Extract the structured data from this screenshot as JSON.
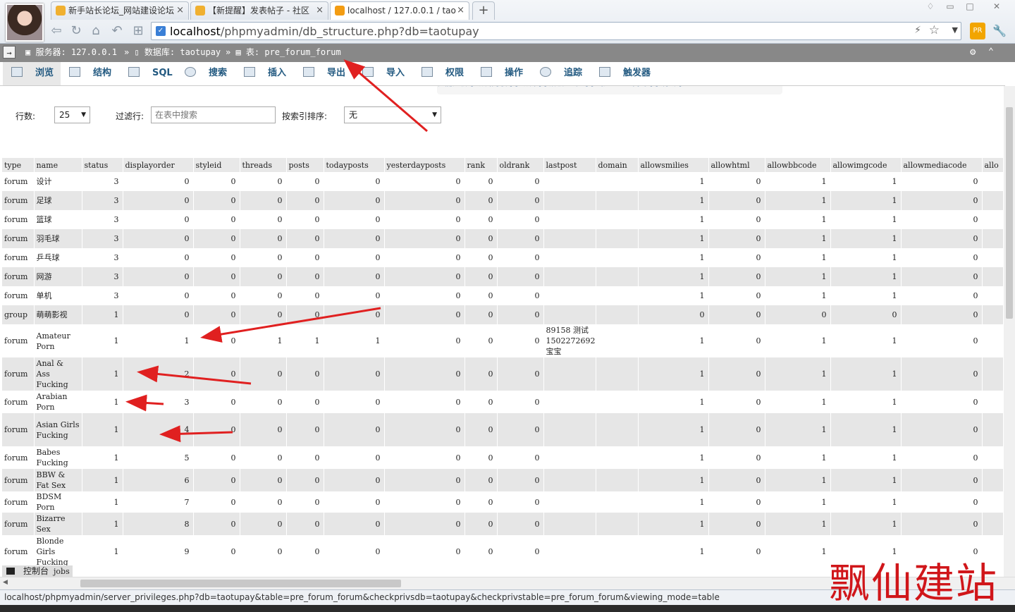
{
  "browser": {
    "tabs": [
      {
        "title": "新手站长论坛_网站建设论坛",
        "close": "×"
      },
      {
        "title": "【新提醒】发表帖子 - 社区",
        "close": "×"
      },
      {
        "title": "localhost / 127.0.0.1 / tao",
        "close": "×"
      }
    ],
    "new_tab": "+",
    "url_host": "localhost",
    "url_path": "/phpmyadmin/db_structure.php?db=taotupay"
  },
  "pma": {
    "crumbs": {
      "server": "服务器: 127.0.0.1",
      "database": "数据库: taotupay",
      "table": "表: pre_forum_forum"
    },
    "menu": [
      "浏览",
      "结构",
      "SQL",
      "搜索",
      "插入",
      "导出",
      "导入",
      "权限",
      "操作",
      "追踪",
      "触发器"
    ],
    "subline": "性能分析 [ 编辑内联 ] [ 编辑 ] [ 解析 SQL ] [ 创建 PHP 代码 ] [ 刷新 ]"
  },
  "filters": {
    "rows_label": "行数:",
    "rows_value": "25",
    "filter_label": "过滤行:",
    "filter_placeholder": "在表中搜索",
    "sort_label": "按索引排序:",
    "sort_value": "无"
  },
  "table": {
    "columns": [
      "type",
      "name",
      "status",
      "displayorder",
      "styleid",
      "threads",
      "posts",
      "todayposts",
      "yesterdayposts",
      "rank",
      "oldrank",
      "lastpost",
      "domain",
      "allowsmilies",
      "allowhtml",
      "allowbbcode",
      "allowimgcode",
      "allowmediacode",
      "allo"
    ],
    "rows": [
      [
        "forum",
        "设计",
        "3",
        "0",
        "0",
        "0",
        "0",
        "0",
        "0",
        "0",
        "0",
        "",
        "",
        "1",
        "0",
        "1",
        "1",
        "0"
      ],
      [
        "forum",
        "足球",
        "3",
        "0",
        "0",
        "0",
        "0",
        "0",
        "0",
        "0",
        "0",
        "",
        "",
        "1",
        "0",
        "1",
        "1",
        "0"
      ],
      [
        "forum",
        "篮球",
        "3",
        "0",
        "0",
        "0",
        "0",
        "0",
        "0",
        "0",
        "0",
        "",
        "",
        "1",
        "0",
        "1",
        "1",
        "0"
      ],
      [
        "forum",
        "羽毛球",
        "3",
        "0",
        "0",
        "0",
        "0",
        "0",
        "0",
        "0",
        "0",
        "",
        "",
        "1",
        "0",
        "1",
        "1",
        "0"
      ],
      [
        "forum",
        "乒乓球",
        "3",
        "0",
        "0",
        "0",
        "0",
        "0",
        "0",
        "0",
        "0",
        "",
        "",
        "1",
        "0",
        "1",
        "1",
        "0"
      ],
      [
        "forum",
        "网游",
        "3",
        "0",
        "0",
        "0",
        "0",
        "0",
        "0",
        "0",
        "0",
        "",
        "",
        "1",
        "0",
        "1",
        "1",
        "0"
      ],
      [
        "forum",
        "单机",
        "3",
        "0",
        "0",
        "0",
        "0",
        "0",
        "0",
        "0",
        "0",
        "",
        "",
        "1",
        "0",
        "1",
        "1",
        "0"
      ],
      [
        "group",
        "萌萌影视",
        "1",
        "0",
        "0",
        "0",
        "0",
        "0",
        "0",
        "0",
        "0",
        "",
        "",
        "0",
        "0",
        "0",
        "0",
        "0"
      ],
      [
        "forum",
        "Amateur Porn",
        "1",
        "1",
        "0",
        "1",
        "1",
        "1",
        "0",
        "0",
        "0",
        "89158 测试 1502272692 宝宝",
        "",
        "1",
        "0",
        "1",
        "1",
        "0"
      ],
      [
        "forum",
        "Anal & Ass Fucking",
        "1",
        "2",
        "0",
        "0",
        "0",
        "0",
        "0",
        "0",
        "0",
        "",
        "",
        "1",
        "0",
        "1",
        "1",
        "0"
      ],
      [
        "forum",
        "Arabian Porn",
        "1",
        "3",
        "0",
        "0",
        "0",
        "0",
        "0",
        "0",
        "0",
        "",
        "",
        "1",
        "0",
        "1",
        "1",
        "0"
      ],
      [
        "forum",
        "Asian Girls Fucking",
        "1",
        "4",
        "0",
        "0",
        "0",
        "0",
        "0",
        "0",
        "0",
        "",
        "",
        "1",
        "0",
        "1",
        "1",
        "0"
      ],
      [
        "forum",
        "Babes Fucking",
        "1",
        "5",
        "0",
        "0",
        "0",
        "0",
        "0",
        "0",
        "0",
        "",
        "",
        "1",
        "0",
        "1",
        "1",
        "0"
      ],
      [
        "forum",
        "BBW & Fat Sex",
        "1",
        "6",
        "0",
        "0",
        "0",
        "0",
        "0",
        "0",
        "0",
        "",
        "",
        "1",
        "0",
        "1",
        "1",
        "0"
      ],
      [
        "forum",
        "BDSM Porn",
        "1",
        "7",
        "0",
        "0",
        "0",
        "0",
        "0",
        "0",
        "0",
        "",
        "",
        "1",
        "0",
        "1",
        "1",
        "0"
      ],
      [
        "forum",
        "Bizarre Sex",
        "1",
        "8",
        "0",
        "0",
        "0",
        "0",
        "0",
        "0",
        "0",
        "",
        "",
        "1",
        "0",
        "1",
        "1",
        "0"
      ],
      [
        "forum",
        "Blonde Girls Fucking",
        "1",
        "9",
        "0",
        "0",
        "0",
        "0",
        "0",
        "0",
        "0",
        "",
        "",
        "1",
        "0",
        "1",
        "1",
        "0"
      ]
    ]
  },
  "console": {
    "label": "控制台",
    "jobs": "jobs"
  },
  "statusbar": "localhost/phpmyadmin/server_privileges.php?db=taotupay&table=pre_forum_forum&checkprivsdb=taotupay&checkprivstable=pre_forum_forum&viewing_mode=table",
  "watermark": "飘仙建站",
  "colors": {
    "arrow": "#e02020",
    "pma_bar": "#888888",
    "link": "#235a81",
    "row_alt": "#e6e6e6"
  }
}
